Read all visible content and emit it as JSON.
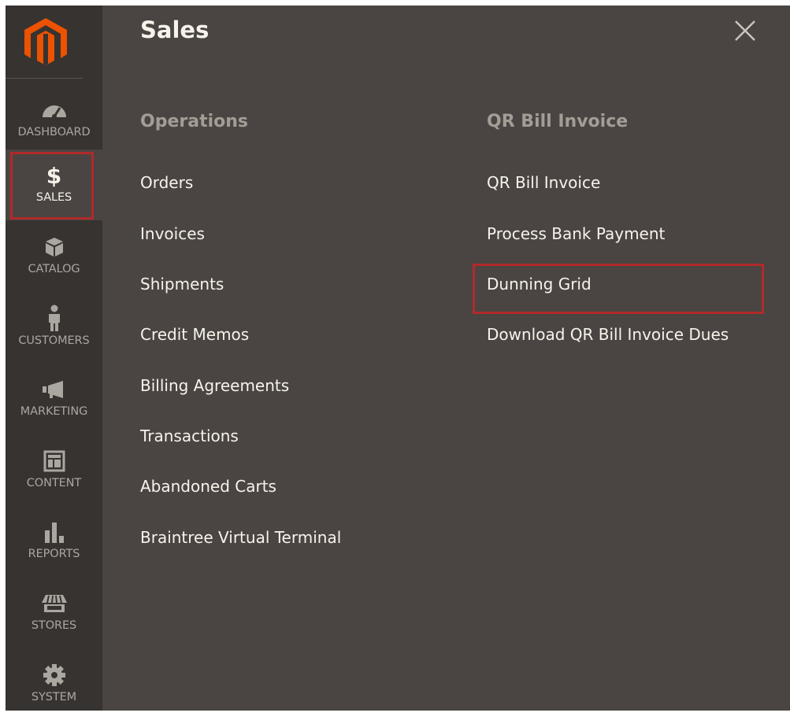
{
  "sidebar": {
    "items": [
      {
        "key": "dashboard",
        "label": "DASHBOARD",
        "icon": "dashboard-icon"
      },
      {
        "key": "sales",
        "label": "SALES",
        "icon": "dollar-icon",
        "active": true
      },
      {
        "key": "catalog",
        "label": "CATALOG",
        "icon": "catalog-box-icon"
      },
      {
        "key": "customers",
        "label": "CUSTOMERS",
        "icon": "customer-person-icon"
      },
      {
        "key": "marketing",
        "label": "MARKETING",
        "icon": "megaphone-icon"
      },
      {
        "key": "content",
        "label": "CONTENT",
        "icon": "content-layout-icon"
      },
      {
        "key": "reports",
        "label": "REPORTS",
        "icon": "bar-chart-icon"
      },
      {
        "key": "stores",
        "label": "STORES",
        "icon": "storefront-icon"
      },
      {
        "key": "system",
        "label": "SYSTEM",
        "icon": "gear-icon"
      }
    ],
    "dollar_glyph": "$"
  },
  "panel": {
    "title": "Sales",
    "close_glyph": "×",
    "columns": [
      {
        "heading": "Operations",
        "links": [
          "Orders",
          "Invoices",
          "Shipments",
          "Credit Memos",
          "Billing Agreements",
          "Transactions",
          "Abandoned Carts",
          "Braintree Virtual Terminal"
        ]
      },
      {
        "heading": "QR Bill Invoice",
        "links": [
          "QR Bill Invoice",
          "Process Bank Payment",
          "Dunning Grid",
          "Download QR Bill Invoice Dues"
        ]
      }
    ]
  },
  "colors": {
    "sidebar_bg": "#373330",
    "panel_bg": "#4a4542",
    "highlight_red": "#b12a2a",
    "text_light": "#f7f3eb",
    "text_muted": "#a39d96"
  }
}
